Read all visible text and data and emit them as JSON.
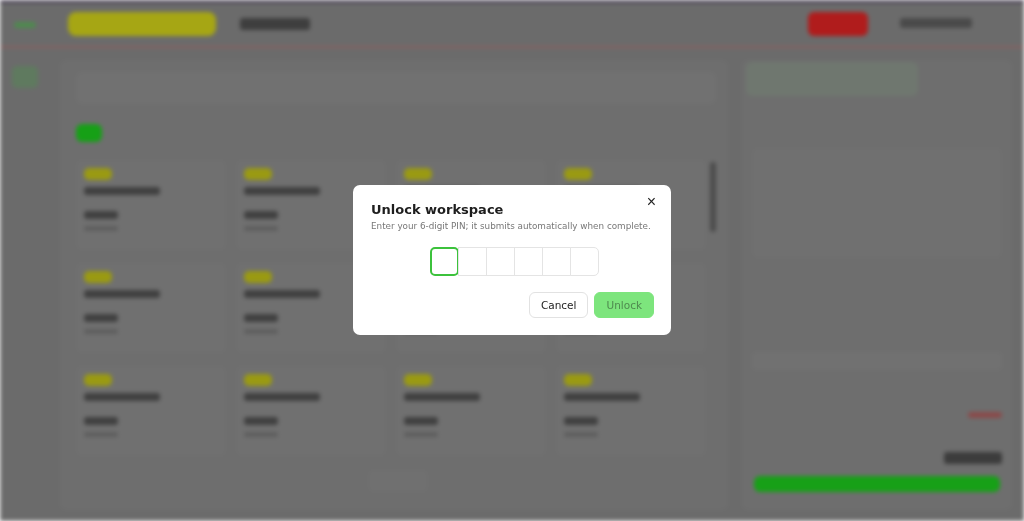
{
  "dialog": {
    "title": "Unlock workspace",
    "message": "Enter your 6-digit PIN; it submits automatically when complete.",
    "close_glyph": "×",
    "pin_boxes": [
      {
        "focused": true
      },
      {
        "focused": false
      },
      {
        "focused": false
      },
      {
        "focused": false
      },
      {
        "focused": false
      },
      {
        "focused": false
      }
    ],
    "buttons": [
      {
        "label": "Cancel",
        "kind": "secondary",
        "disabled": false
      },
      {
        "label": "Unlock",
        "kind": "primary",
        "disabled": true
      }
    ]
  }
}
